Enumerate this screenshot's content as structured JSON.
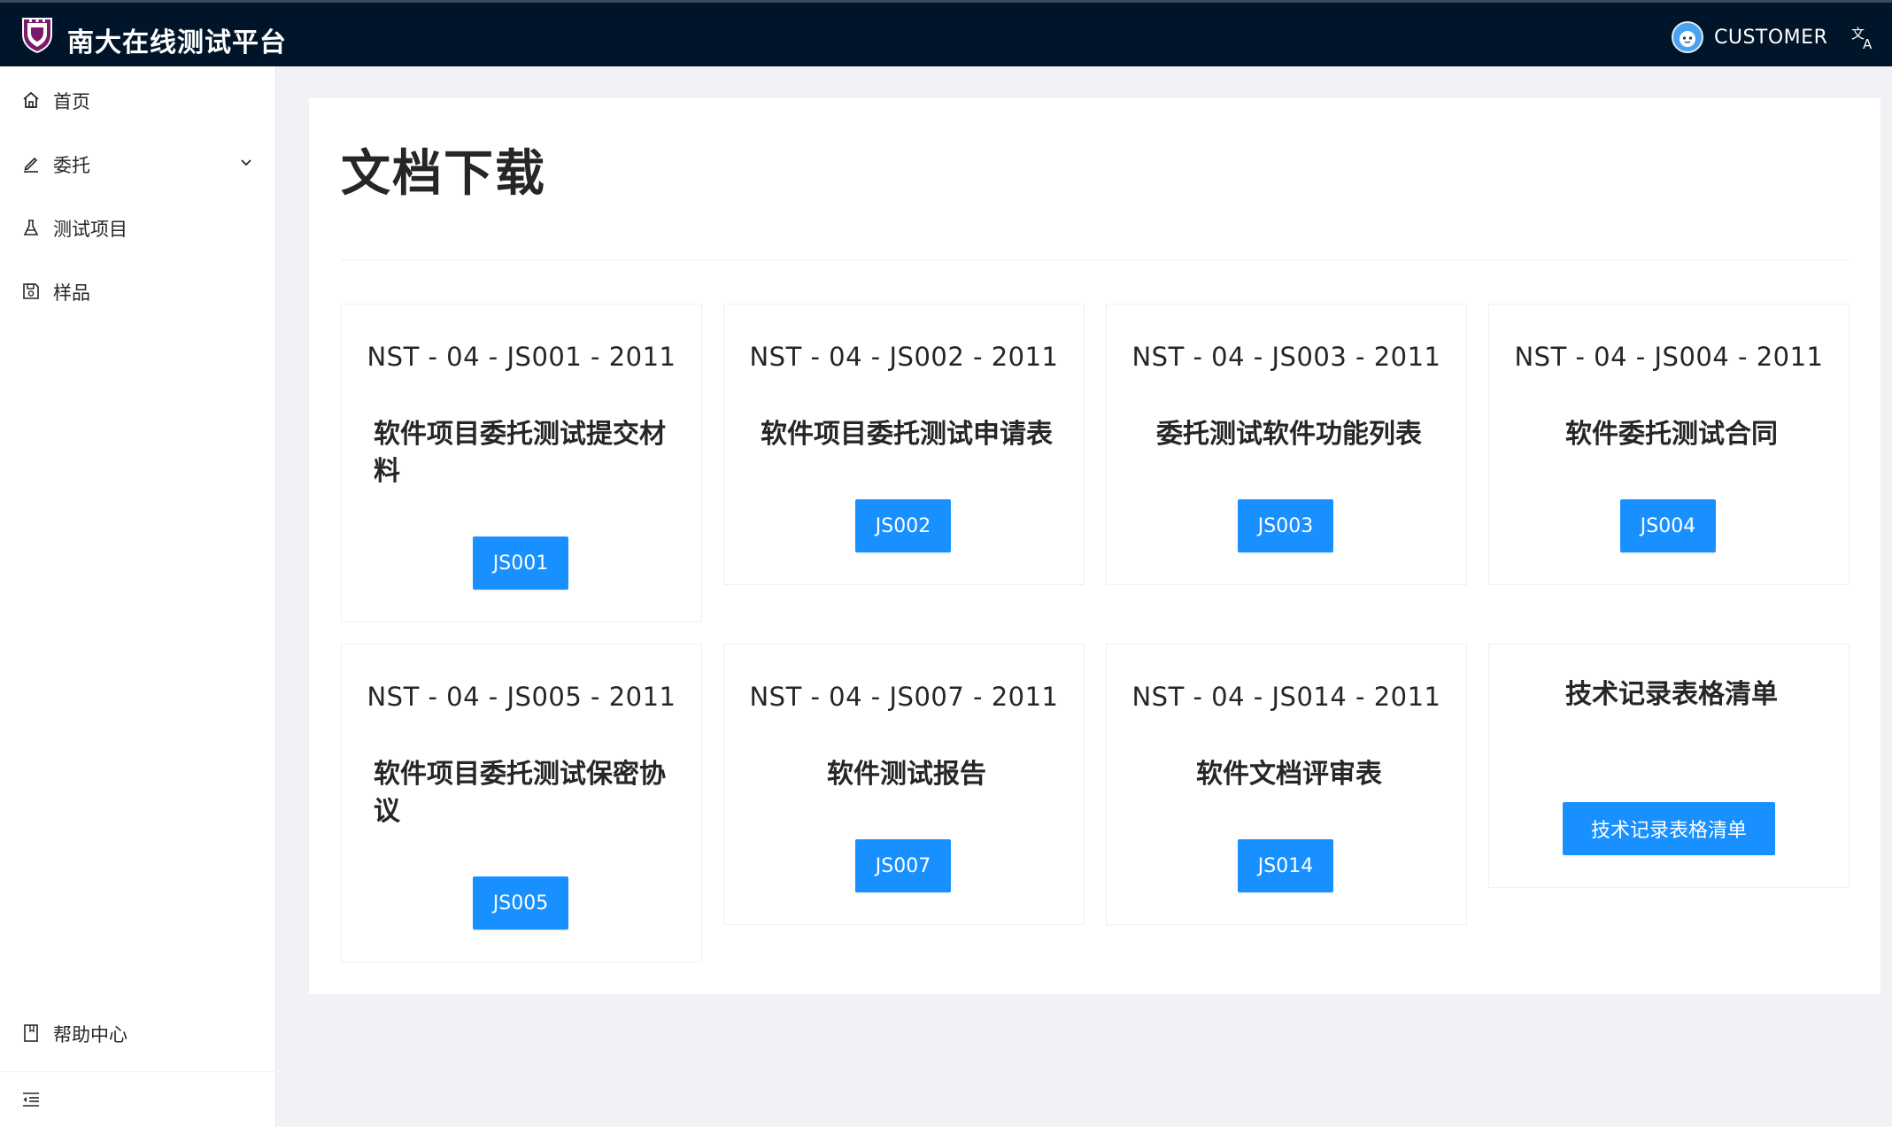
{
  "header": {
    "app_title": "南大在线测试平台",
    "user_name": "CUSTOMER",
    "language_icon": "translate-icon",
    "logo_icon": "university-shield-logo"
  },
  "sidebar": {
    "items": [
      {
        "label": "首页",
        "icon": "home-icon"
      },
      {
        "label": "委托",
        "icon": "edit-icon",
        "has_submenu": true
      },
      {
        "label": "测试项目",
        "icon": "experiment-icon"
      },
      {
        "label": "样品",
        "icon": "save-icon"
      }
    ],
    "help": {
      "label": "帮助中心",
      "icon": "book-icon"
    },
    "collapse_icon": "menu-fold-icon"
  },
  "main": {
    "title": "文档下载",
    "cards": [
      {
        "code": "NST - 04 - JS001 - 2011",
        "name": "软件项目委托测试提交材料",
        "button": "JS001"
      },
      {
        "code": "NST - 04 - JS002 - 2011",
        "name": "软件项目委托测试申请表",
        "button": "JS002"
      },
      {
        "code": "NST - 04 - JS003 - 2011",
        "name": "委托测试软件功能列表",
        "button": "JS003"
      },
      {
        "code": "NST - 04 - JS004 - 2011",
        "name": "软件委托测试合同",
        "button": "JS004"
      },
      {
        "code": "NST - 04 - JS005 - 2011",
        "name": "软件项目委托测试保密协议",
        "button": "JS005"
      },
      {
        "code": "NST - 04 - JS007 - 2011",
        "name": "软件测试报告",
        "button": "JS007"
      },
      {
        "code": "NST - 04 - JS014 - 2011",
        "name": "软件文档评审表",
        "button": "JS014"
      },
      {
        "code": "",
        "name": "技术记录表格清单",
        "button": "技术记录表格清单"
      }
    ]
  },
  "colors": {
    "header_bg": "#001529",
    "primary": "#1890ff",
    "page_bg": "#f0f2f5"
  }
}
